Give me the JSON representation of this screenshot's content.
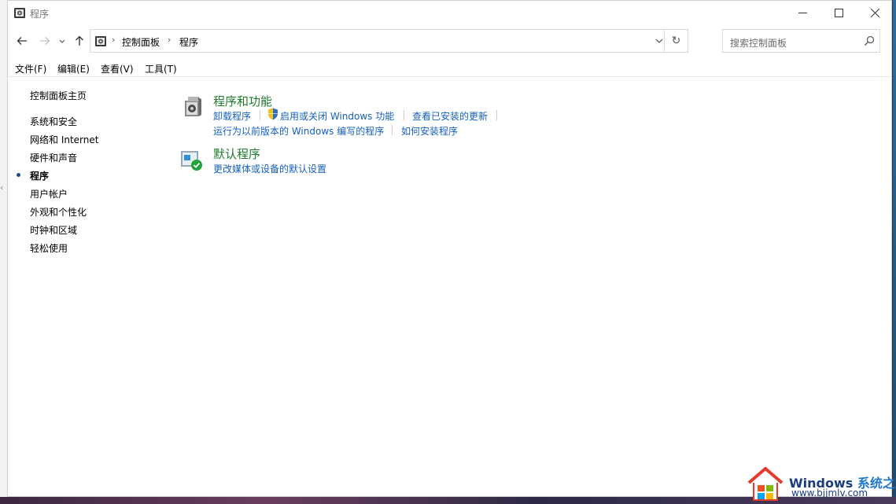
{
  "window": {
    "title": "程序"
  },
  "address": {
    "crumbs": [
      "控制面板",
      "程序"
    ]
  },
  "search": {
    "placeholder": "搜索控制面板"
  },
  "menu": [
    "文件(F)",
    "编辑(E)",
    "查看(V)",
    "工具(T)"
  ],
  "sidebar": {
    "home": "控制面板主页",
    "items": [
      "系统和安全",
      "网络和 Internet",
      "硬件和声音",
      "程序",
      "用户帐户",
      "外观和个性化",
      "时钟和区域",
      "轻松使用"
    ],
    "current_index": 3
  },
  "categories": [
    {
      "title": "程序和功能",
      "tasks_row1": [
        "卸载程序",
        "启用或关闭 Windows 功能",
        "查看已安装的更新"
      ],
      "tasks_row2": [
        "运行为以前版本的 Windows 编写的程序",
        "如何安装程序"
      ]
    },
    {
      "title": "默认程序",
      "tasks_row1": [
        "更改媒体或设备的默认设置"
      ]
    }
  ],
  "watermark": {
    "title": "Windows",
    "title_cn": "系统之家",
    "url": "www.bjjmlv.com"
  },
  "colors": {
    "link": "#1660b8",
    "category_title": "#1e7a2e",
    "accent_blue": "#1a4a8a"
  }
}
